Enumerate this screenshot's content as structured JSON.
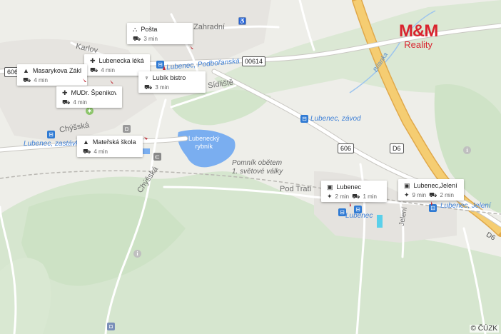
{
  "map": {
    "streets": {
      "zahradni": "Zahradní",
      "karlova": "Karlov",
      "sidliste": "Sídliště",
      "chysska_top": "Chýšská",
      "chysska_side": "Chýšská",
      "pod_trati": "Pod Tratí",
      "bilanka": "Bílanka",
      "jeleni": "Jelení"
    },
    "roads": {
      "r606_left": "606",
      "r00614": "00614",
      "r606_right": "606",
      "d6": "D6",
      "d6_right": "D6"
    },
    "places": {
      "podborianska": "Lubenec, Podbořanská",
      "zavod": "Lubenec, závod",
      "zastavka": "Lubenec, zastávka",
      "lubenec": "Lubenec",
      "jeleni_stop": "Lubenec, Jelení",
      "rybnik_1": "Lubenecký",
      "rybnik_2": "rybník",
      "pomnik_1": "Pomník obětem",
      "pomnik_2": "1. světové války"
    },
    "poi_cards": [
      {
        "title": "Pošta",
        "icon": "post-icon",
        "mode_icon": "car-icon",
        "time": "3 min"
      },
      {
        "title": "Lubenecka lékárna",
        "icon": "pharmacy-icon",
        "mode_icon": "car-icon",
        "time": "4 min"
      },
      {
        "title": "Masarykova Zákl...",
        "icon": "school-icon",
        "mode_icon": "car-icon",
        "time": "4 min"
      },
      {
        "title": "Lubík bistro",
        "icon": "restaurant-icon",
        "mode_icon": "car-icon",
        "time": "3 min"
      },
      {
        "title": "MUDr. Špeniková ...",
        "icon": "doctor-icon",
        "mode_icon": "car-icon",
        "time": "4 min"
      },
      {
        "title": "Mateřská škola L...",
        "icon": "school-icon",
        "mode_icon": "car-icon",
        "time": "4 min"
      },
      {
        "title": "Lubenec",
        "icon": "bus-icon",
        "walk_time": "2 min",
        "car_time": "1 min"
      },
      {
        "title": "Lubenec,Jelení",
        "icon": "bus-icon",
        "walk_time": "9 min",
        "car_time": "2 min"
      }
    ]
  },
  "logo": {
    "line1": "M&M",
    "line2": "Reality"
  },
  "copyright": "© ČÚZK",
  "colors": {
    "water": "#7aaef0",
    "forest": "#cfe3c9",
    "highway": "#f2c86a",
    "road_main": "#ffffff",
    "accent": "#d9232e",
    "transit": "#2f7ad3"
  }
}
